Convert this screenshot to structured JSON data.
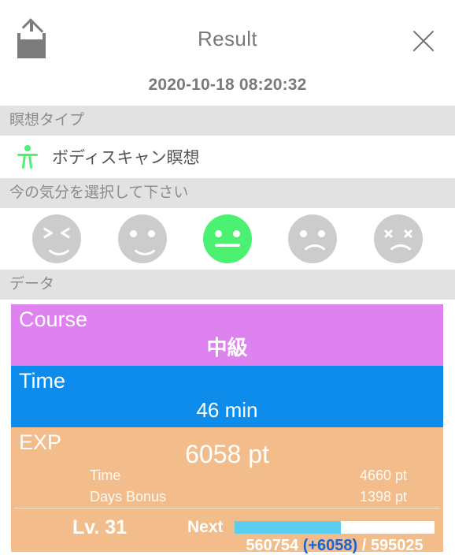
{
  "header": {
    "title": "Result",
    "share_icon": "share-upload-icon",
    "close_icon": "close-icon",
    "timestamp": "2020-10-18 08:20:32"
  },
  "sections": {
    "meditation_type": {
      "header": "瞑想タイプ",
      "icon": "person-accessibility-icon",
      "value": "ボディスキャン瞑想"
    },
    "mood": {
      "header": "今の気分を選択して下さい",
      "options": [
        {
          "name": "mood-very-happy",
          "selected": false
        },
        {
          "name": "mood-happy",
          "selected": false
        },
        {
          "name": "mood-neutral",
          "selected": true
        },
        {
          "name": "mood-sad",
          "selected": false
        },
        {
          "name": "mood-very-sad",
          "selected": false
        }
      ],
      "selected_index": 2
    },
    "data": {
      "header": "データ"
    }
  },
  "panels": {
    "course": {
      "title": "Course",
      "value": "中級",
      "color": "#dd82ee"
    },
    "time": {
      "title": "Time",
      "value": "46 min",
      "color": "#0d8cec"
    },
    "exp": {
      "title": "EXP",
      "total": "6058 pt",
      "color": "#f2bd8a",
      "rows": [
        {
          "label": "Time",
          "value": "4660 pt"
        },
        {
          "label": "Days Bonus",
          "value": "1398 pt"
        }
      ],
      "level": "Lv. 31",
      "next_label": "Next",
      "progress_percent": 53,
      "progress_current": "560754",
      "progress_gain": "(+6058)",
      "progress_separator": "/",
      "progress_total": "595025",
      "progress_fill_color": "#5bcdef",
      "gain_color": "#1464dc"
    }
  }
}
